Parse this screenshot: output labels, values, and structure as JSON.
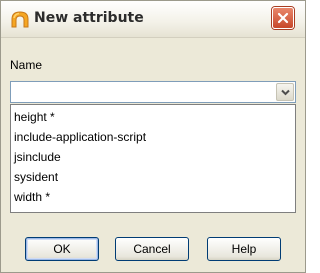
{
  "window": {
    "title": "New attribute",
    "icon": "app-icon",
    "close_icon": "close-icon",
    "accent": "#c7472a"
  },
  "form": {
    "name_label": "Name",
    "name_value": "",
    "dropdown_icon": "chevron-down-icon",
    "options": [
      "height *",
      "include-application-script",
      "jsinclude",
      "sysident",
      "width *"
    ]
  },
  "buttons": {
    "ok": "OK",
    "cancel": "Cancel",
    "help": "Help"
  }
}
